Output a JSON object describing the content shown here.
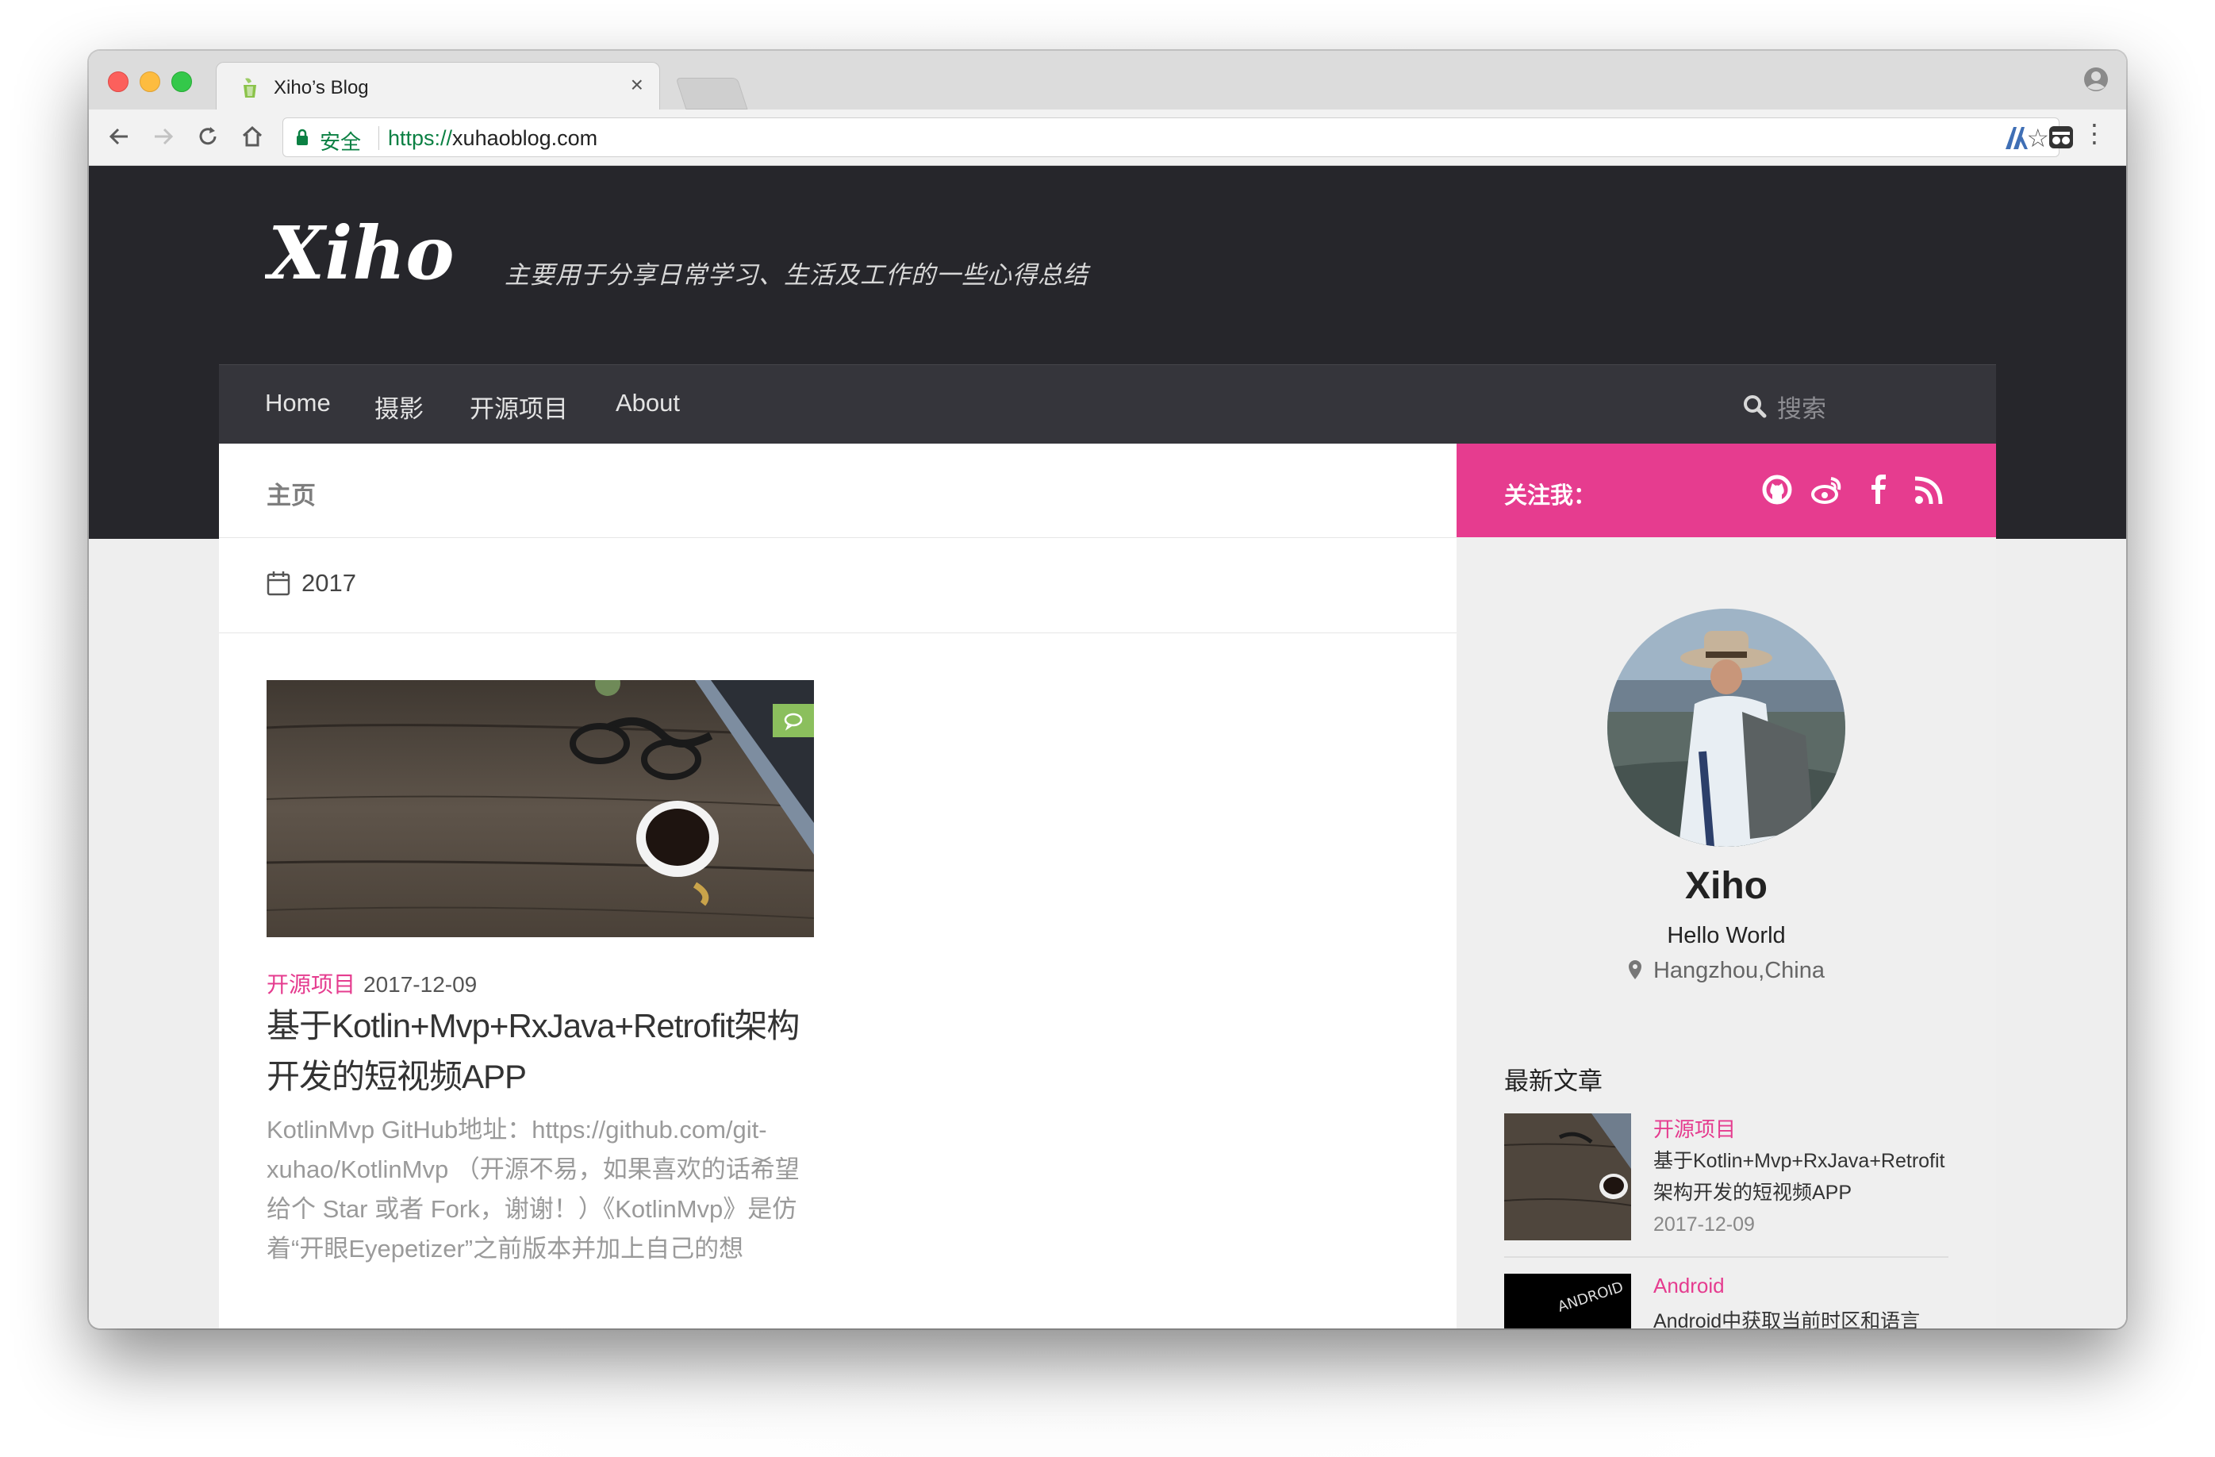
{
  "browser": {
    "tab_title": "Xiho’s Blog",
    "tab_close": "×",
    "secure_label": "安全",
    "url_scheme": "https://",
    "url_host": "xuhaoblog.com",
    "star_icon": "☆",
    "menu_icon": "⋮"
  },
  "site": {
    "logo_text": "Xiho",
    "tagline": "主要用于分享日常学习、生活及工作的一些心得总结",
    "nav": [
      "Home",
      "摄影",
      "开源项目",
      "About"
    ],
    "search_placeholder": "搜索"
  },
  "main": {
    "breadcrumb": "主页",
    "year": "2017",
    "post": {
      "category": "开源项目",
      "date": "2017-12-09",
      "title": "基于Kotlin+Mvp+RxJava+Retrofit架构开发的短视频APP",
      "excerpt": "KotlinMvp GitHub地址：https://github.com/git-xuhao/KotlinMvp （开源不易，如果喜欢的话希望给个 Star 或者 Fork，谢谢！）《KotlinMvp》是仿着“开眼Eyepetizer”之前版本并加上自己的想"
    }
  },
  "sidebar": {
    "follow_label": "关注我：",
    "social_icons": [
      "github-icon",
      "weibo-icon",
      "facebook-icon",
      "rss-icon"
    ],
    "profile": {
      "name": "Xiho",
      "bio": "Hello World",
      "location": "Hangzhou,China"
    },
    "latest_title": "最新文章",
    "latest": [
      {
        "category": "开源项目",
        "title": "基于Kotlin+Mvp+RxJava+Retrofit架构开发的短视频APP",
        "date": "2017-12-09"
      },
      {
        "category": "Android",
        "title": "Android中获取当前时区和语言",
        "date": ""
      }
    ]
  },
  "colors": {
    "accent": "#e63c8f",
    "header_bg": "#26262b",
    "nav_bg": "#35353b",
    "comment_badge": "#8bbf5d"
  }
}
